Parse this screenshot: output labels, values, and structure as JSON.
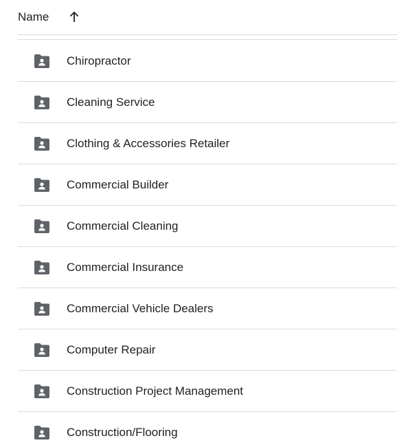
{
  "header": {
    "name_label": "Name",
    "sort_icon": "arrow-up-icon"
  },
  "folders": [
    {
      "label": "Chiropractor",
      "icon": "shared-folder-icon"
    },
    {
      "label": "Cleaning Service",
      "icon": "shared-folder-icon"
    },
    {
      "label": "Clothing & Accessories Retailer",
      "icon": "shared-folder-icon"
    },
    {
      "label": "Commercial Builder",
      "icon": "shared-folder-icon"
    },
    {
      "label": "Commercial Cleaning",
      "icon": "shared-folder-icon"
    },
    {
      "label": "Commercial Insurance",
      "icon": "shared-folder-icon"
    },
    {
      "label": "Commercial Vehicle Dealers",
      "icon": "shared-folder-icon"
    },
    {
      "label": "Computer Repair",
      "icon": "shared-folder-icon"
    },
    {
      "label": "Construction Project Management",
      "icon": "shared-folder-icon"
    },
    {
      "label": "Construction/Flooring",
      "icon": "shared-folder-icon"
    }
  ],
  "colors": {
    "icon": "#5f6368",
    "divider": "#dadce0",
    "text": "#1f1f1f"
  }
}
